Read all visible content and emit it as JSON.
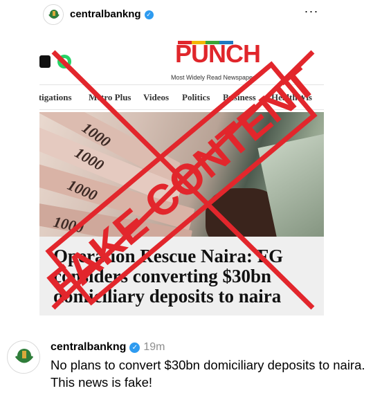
{
  "header": {
    "username": "centralbankng",
    "verified_icon": "verified-check-icon",
    "more_label": "···"
  },
  "article_screenshot": {
    "logo": "PUNCH",
    "tagline": "Most Widely Read Newspaper",
    "nav_items": [
      "estigations",
      "Metro Plus",
      "Videos",
      "Politics",
      "Business",
      "HealthWis"
    ],
    "headline": "Operation Rescue Naira: FG considers converting $30bn domiciliary deposits to naira",
    "stamp_text": "FAKE CONTENT",
    "banknote_text": [
      "1000",
      "1000",
      "1000",
      "1000"
    ],
    "colors": {
      "brand_red": "#e0262b",
      "stamp_red": "#e2262c"
    }
  },
  "caption": {
    "username": "centralbankng",
    "time": "19m",
    "text": "No plans to convert $30bn domiciliary deposits to naira. This news is fake!"
  }
}
